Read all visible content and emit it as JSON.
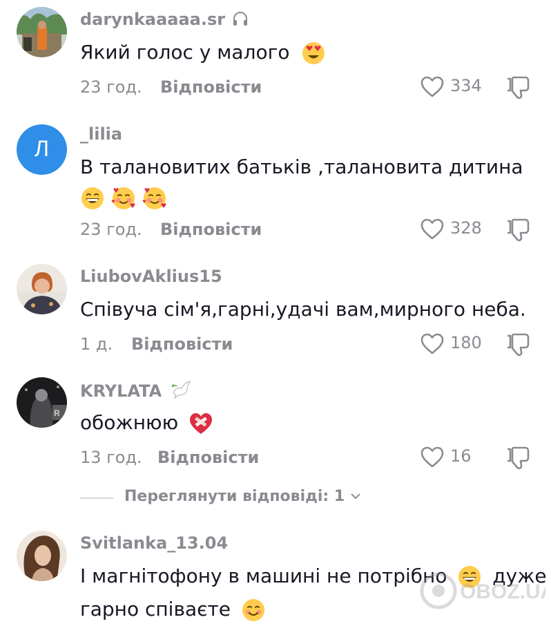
{
  "comments": [
    {
      "username": "darynkaaaaa.sr",
      "username_icon": "headphones-icon",
      "text": "Який голос у малого",
      "emojis": [
        "heart-eyes-emoji"
      ],
      "time": "23 год.",
      "reply_label": "Відповісти",
      "likes": "334"
    },
    {
      "username": "_lilia",
      "avatar_letter": "Л",
      "avatar_color": "#2f8ee8",
      "text": "В талановитих батьків ,талановита дитина",
      "emojis": [
        "grinning-emoji",
        "smiling-hearts-emoji",
        "smiling-hearts-emoji"
      ],
      "time": "23 год.",
      "reply_label": "Відповісти",
      "likes": "328"
    },
    {
      "username": "LiubovAklius15",
      "text": "Співуча сім'я,гарні,удачі вам,мирного неба.",
      "time": "1 д.",
      "reply_label": "Відповісти",
      "likes": "180"
    },
    {
      "username": "KRYLATA",
      "username_icon": "dove-icon",
      "text": "обожнюю",
      "emojis": [
        "mending-heart-emoji"
      ],
      "time": "13 год.",
      "reply_label": "Відповісти",
      "likes": "16"
    },
    {
      "username": "Svitlanka_13.04",
      "text_line1": "І магнітофону в машині не потрібно",
      "text_line1_tail": "дуже",
      "text_line2": "гарно співаєте",
      "emojis": [
        "grinning-emoji",
        "smiling-emoji"
      ]
    }
  ],
  "view_replies": {
    "label": "Переглянути відповіді: 1"
  },
  "watermark": {
    "text": "OBOZ.UA"
  },
  "colors": {
    "muted": "#8a8b91",
    "text": "#161823",
    "accent": "#2f8ee8"
  }
}
